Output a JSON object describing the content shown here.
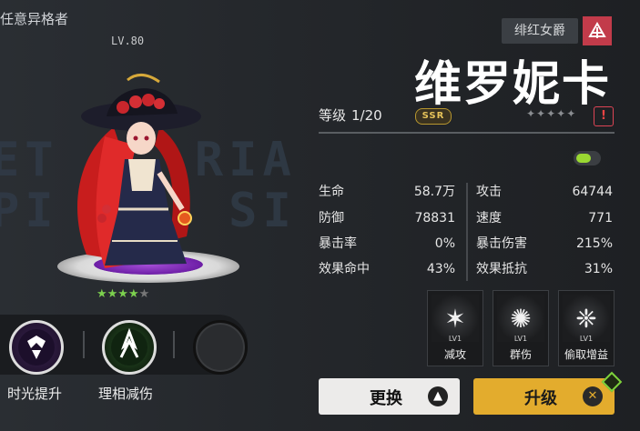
{
  "header": {
    "top_label": "任意异格者",
    "level": "LV.80"
  },
  "watermark": "ET    RIA\nPI     SI",
  "character": {
    "name": "维罗妮卡",
    "faction": "绯红女爵",
    "faction_icon": "faction-emblem-icon",
    "grade_label": "等级",
    "grade_value": "1/20",
    "rarity": "SSR",
    "star_glyphs": "✦✦✦✦✦",
    "warn_glyph": "!",
    "awaken_stars": {
      "filled": 4,
      "total": 5
    },
    "star_filled_glyphs": "★★★★",
    "star_empty_glyphs": "★"
  },
  "stats": {
    "left": [
      {
        "label": "生命",
        "value": "58.7万"
      },
      {
        "label": "防御",
        "value": "78831"
      },
      {
        "label": "暴击率",
        "value": "0%"
      },
      {
        "label": "效果命中",
        "value": "43%"
      }
    ],
    "right": [
      {
        "label": "攻击",
        "value": "64744"
      },
      {
        "label": "速度",
        "value": "771"
      },
      {
        "label": "暴击伤害",
        "value": "215%"
      },
      {
        "label": "效果抵抗",
        "value": "31%"
      }
    ]
  },
  "toggle_on": true,
  "skills": [
    {
      "name": "减攻",
      "level": "LV1",
      "icon": "attack-down-icon",
      "glyph": "✶"
    },
    {
      "name": "群伤",
      "level": "LV1",
      "icon": "aoe-damage-icon",
      "glyph": "✺"
    },
    {
      "name": "偷取增益",
      "level": "LV1",
      "icon": "steal-buff-icon",
      "glyph": "❈"
    }
  ],
  "left_skills": [
    {
      "name": "时光提升",
      "icon": "time-boost-icon",
      "color": "#8a5cc7"
    },
    {
      "name": "理相减伤",
      "icon": "damage-reduction-icon",
      "color": "#5fc24a"
    },
    {
      "name": "",
      "icon": "empty-slot-icon",
      "color": "#2a2c2f"
    }
  ],
  "buttons": {
    "change": "更换",
    "change_glyph": "▲",
    "upgrade": "升级",
    "upgrade_glyph": "✕"
  },
  "colors": {
    "accent_gold": "#e3ac2d",
    "faction_red": "#c23b4a",
    "star_green": "#7cd04e"
  }
}
